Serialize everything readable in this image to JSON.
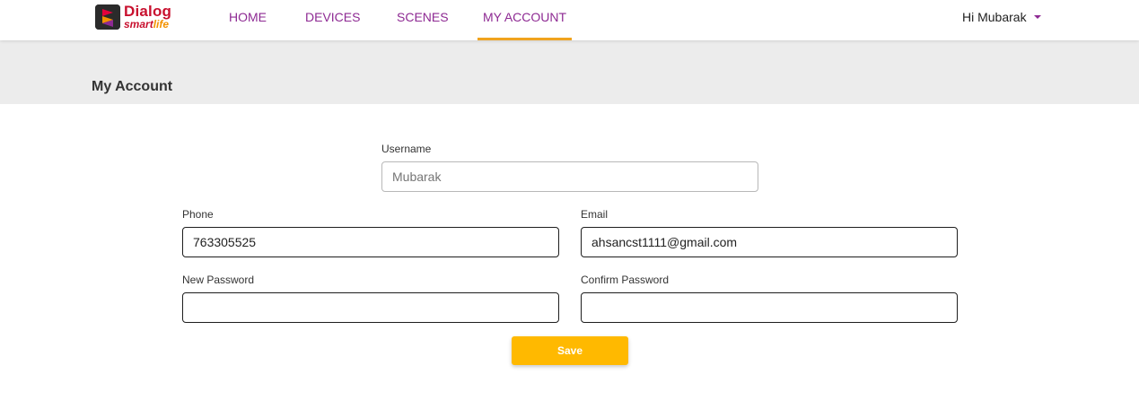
{
  "brand": {
    "name_top": "Dialog",
    "name_bottom_a": "smart",
    "name_bottom_b": "life",
    "logo_icon": "dialog-logo-icon"
  },
  "nav": {
    "items": [
      {
        "label": "HOME"
      },
      {
        "label": "DEVICES"
      },
      {
        "label": "SCENES"
      },
      {
        "label": "MY ACCOUNT",
        "active": true
      }
    ],
    "user_greeting": "Hi Mubarak",
    "user_menu_icon": "caret-down-icon"
  },
  "page": {
    "title": "My Account"
  },
  "form": {
    "username": {
      "label": "Username",
      "value": "",
      "placeholder": "Mubarak"
    },
    "phone": {
      "label": "Phone",
      "value": "763305525"
    },
    "email": {
      "label": "Email",
      "value": "ahsancst1111@gmail.com"
    },
    "new_password": {
      "label": "New Password",
      "value": ""
    },
    "confirm_password": {
      "label": "Confirm Password",
      "value": ""
    },
    "save_label": "Save"
  },
  "colors": {
    "nav_text": "#8e2a93",
    "active_underline": "#f0a31e",
    "save_button": "#ffb900",
    "header_band": "#ececec"
  }
}
